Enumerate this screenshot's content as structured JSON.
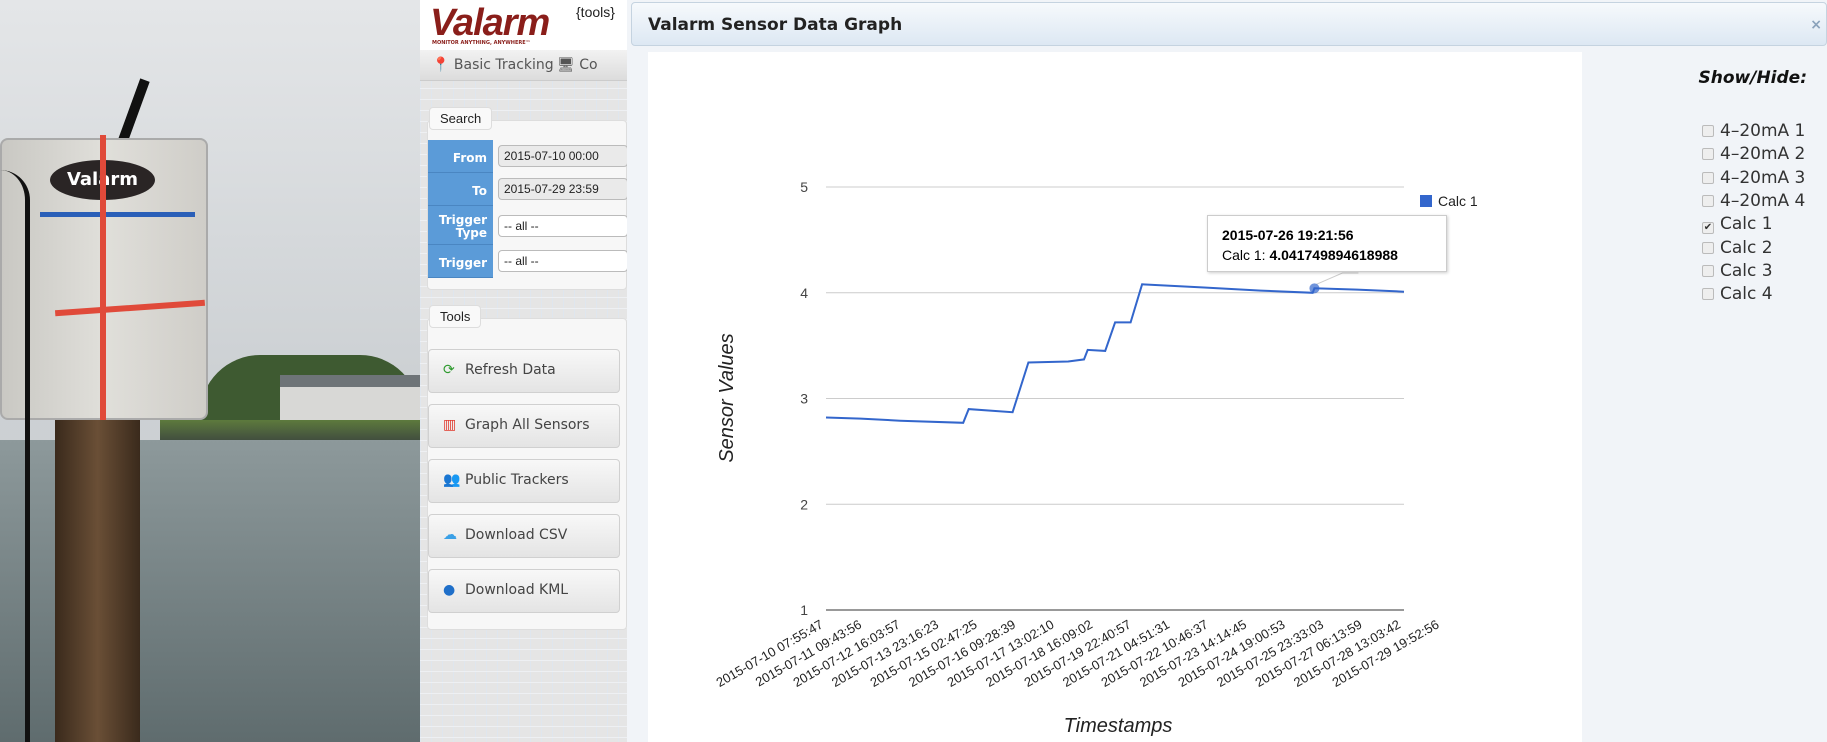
{
  "photo": {
    "box_logo": "Valarm"
  },
  "sidebar": {
    "logo": "Valarm",
    "logo_tagline": "MONITOR ANYTHING, ANYWHERE™",
    "logo_suffix": "{tools}",
    "nav": [
      {
        "label": "Basic Tracking",
        "icon": "map-marker-icon"
      },
      {
        "label": "Co",
        "icon": "monitor-icon"
      }
    ],
    "search": {
      "tab": "Search",
      "from_label": "From",
      "from_value": "2015-07-10 00:00",
      "to_label": "To",
      "to_value": "2015-07-29 23:59",
      "trigger_type_label": "Trigger Type",
      "trigger_type_value": "-- all --",
      "trigger_label": "Trigger",
      "trigger_value": "-- all --"
    },
    "tools": {
      "tab": "Tools",
      "buttons": [
        {
          "label": "Refresh Data",
          "icon": "refresh-icon",
          "color": "#2e9a2e"
        },
        {
          "label": "Graph All Sensors",
          "icon": "bar-chart-icon",
          "color": "#e0382c"
        },
        {
          "label": "Public Trackers",
          "icon": "users-icon",
          "color": "#555555"
        },
        {
          "label": "Download CSV",
          "icon": "cloud-download-icon",
          "color": "#3aa0e6"
        },
        {
          "label": "Download KML",
          "icon": "globe-icon",
          "color": "#1f6fc9"
        }
      ]
    }
  },
  "dialog": {
    "title": "Valarm Sensor Data Graph",
    "close": "×"
  },
  "show_hide": {
    "title": "Show/Hide:",
    "items": [
      {
        "label": "4–20mA 1",
        "checked": false
      },
      {
        "label": "4–20mA 2",
        "checked": false
      },
      {
        "label": "4–20mA 3",
        "checked": false
      },
      {
        "label": "4–20mA 4",
        "checked": false
      },
      {
        "label": "Calc 1",
        "checked": true
      },
      {
        "label": "Calc 2",
        "checked": false
      },
      {
        "label": "Calc 3",
        "checked": false
      },
      {
        "label": "Calc 4",
        "checked": false
      }
    ]
  },
  "tooltip": {
    "timestamp": "2015-07-26 19:21:56",
    "series": "Calc 1: ",
    "value": "4.041749894618988"
  },
  "chart_data": {
    "type": "line",
    "xlabel": "Timestamps",
    "ylabel": "Sensor Values",
    "ylim": [
      1,
      5
    ],
    "yticks": [
      "1",
      "2",
      "3",
      "4",
      "5"
    ],
    "grid": true,
    "legend": "right",
    "xticks": [
      "2015-07-10 07:55:47",
      "2015-07-11 09:43:56",
      "2015-07-12 16:03:57",
      "2015-07-13 23:16:23",
      "2015-07-15 02:47:25",
      "2015-07-16 09:28:39",
      "2015-07-17 13:02:10",
      "2015-07-18 16:09:02",
      "2015-07-19 22:40:57",
      "2015-07-21 04:51:31",
      "2015-07-22 10:46:37",
      "2015-07-23 14:14:45",
      "2015-07-24 19:00:53",
      "2015-07-25 23:33:03",
      "2015-07-27 06:13:59",
      "2015-07-28 13:03:42",
      "2015-07-29 19:52:56"
    ],
    "series": [
      {
        "name": "Calc 1",
        "color": "#3366cc",
        "points": [
          [
            "2015-07-10 07:55:47",
            2.82
          ],
          [
            "2015-07-11 12:00:00",
            2.81
          ],
          [
            "2015-07-12 20:00:00",
            2.79
          ],
          [
            "2015-07-14 23:00:00",
            2.77
          ],
          [
            "2015-07-15 03:30:00",
            2.9
          ],
          [
            "2015-07-16 15:00:00",
            2.87
          ],
          [
            "2015-07-17 03:50:00",
            3.34
          ],
          [
            "2015-07-18 12:00:00",
            3.35
          ],
          [
            "2015-07-19 00:50:00",
            3.37
          ],
          [
            "2015-07-19 03:50:00",
            3.46
          ],
          [
            "2015-07-19 18:00:00",
            3.45
          ],
          [
            "2015-07-20 02:00:00",
            3.72
          ],
          [
            "2015-07-20 14:30:00",
            3.72
          ],
          [
            "2015-07-20 23:50:00",
            4.08
          ],
          [
            "2015-07-23 02:00:00",
            4.05
          ],
          [
            "2015-07-25 00:00:00",
            4.02
          ],
          [
            "2015-07-26 18:00:00",
            4.0
          ],
          [
            "2015-07-26 19:21:56",
            4.0417
          ],
          [
            "2015-07-28 06:00:00",
            4.03
          ],
          [
            "2015-07-29 19:52:56",
            4.01
          ]
        ]
      }
    ]
  }
}
